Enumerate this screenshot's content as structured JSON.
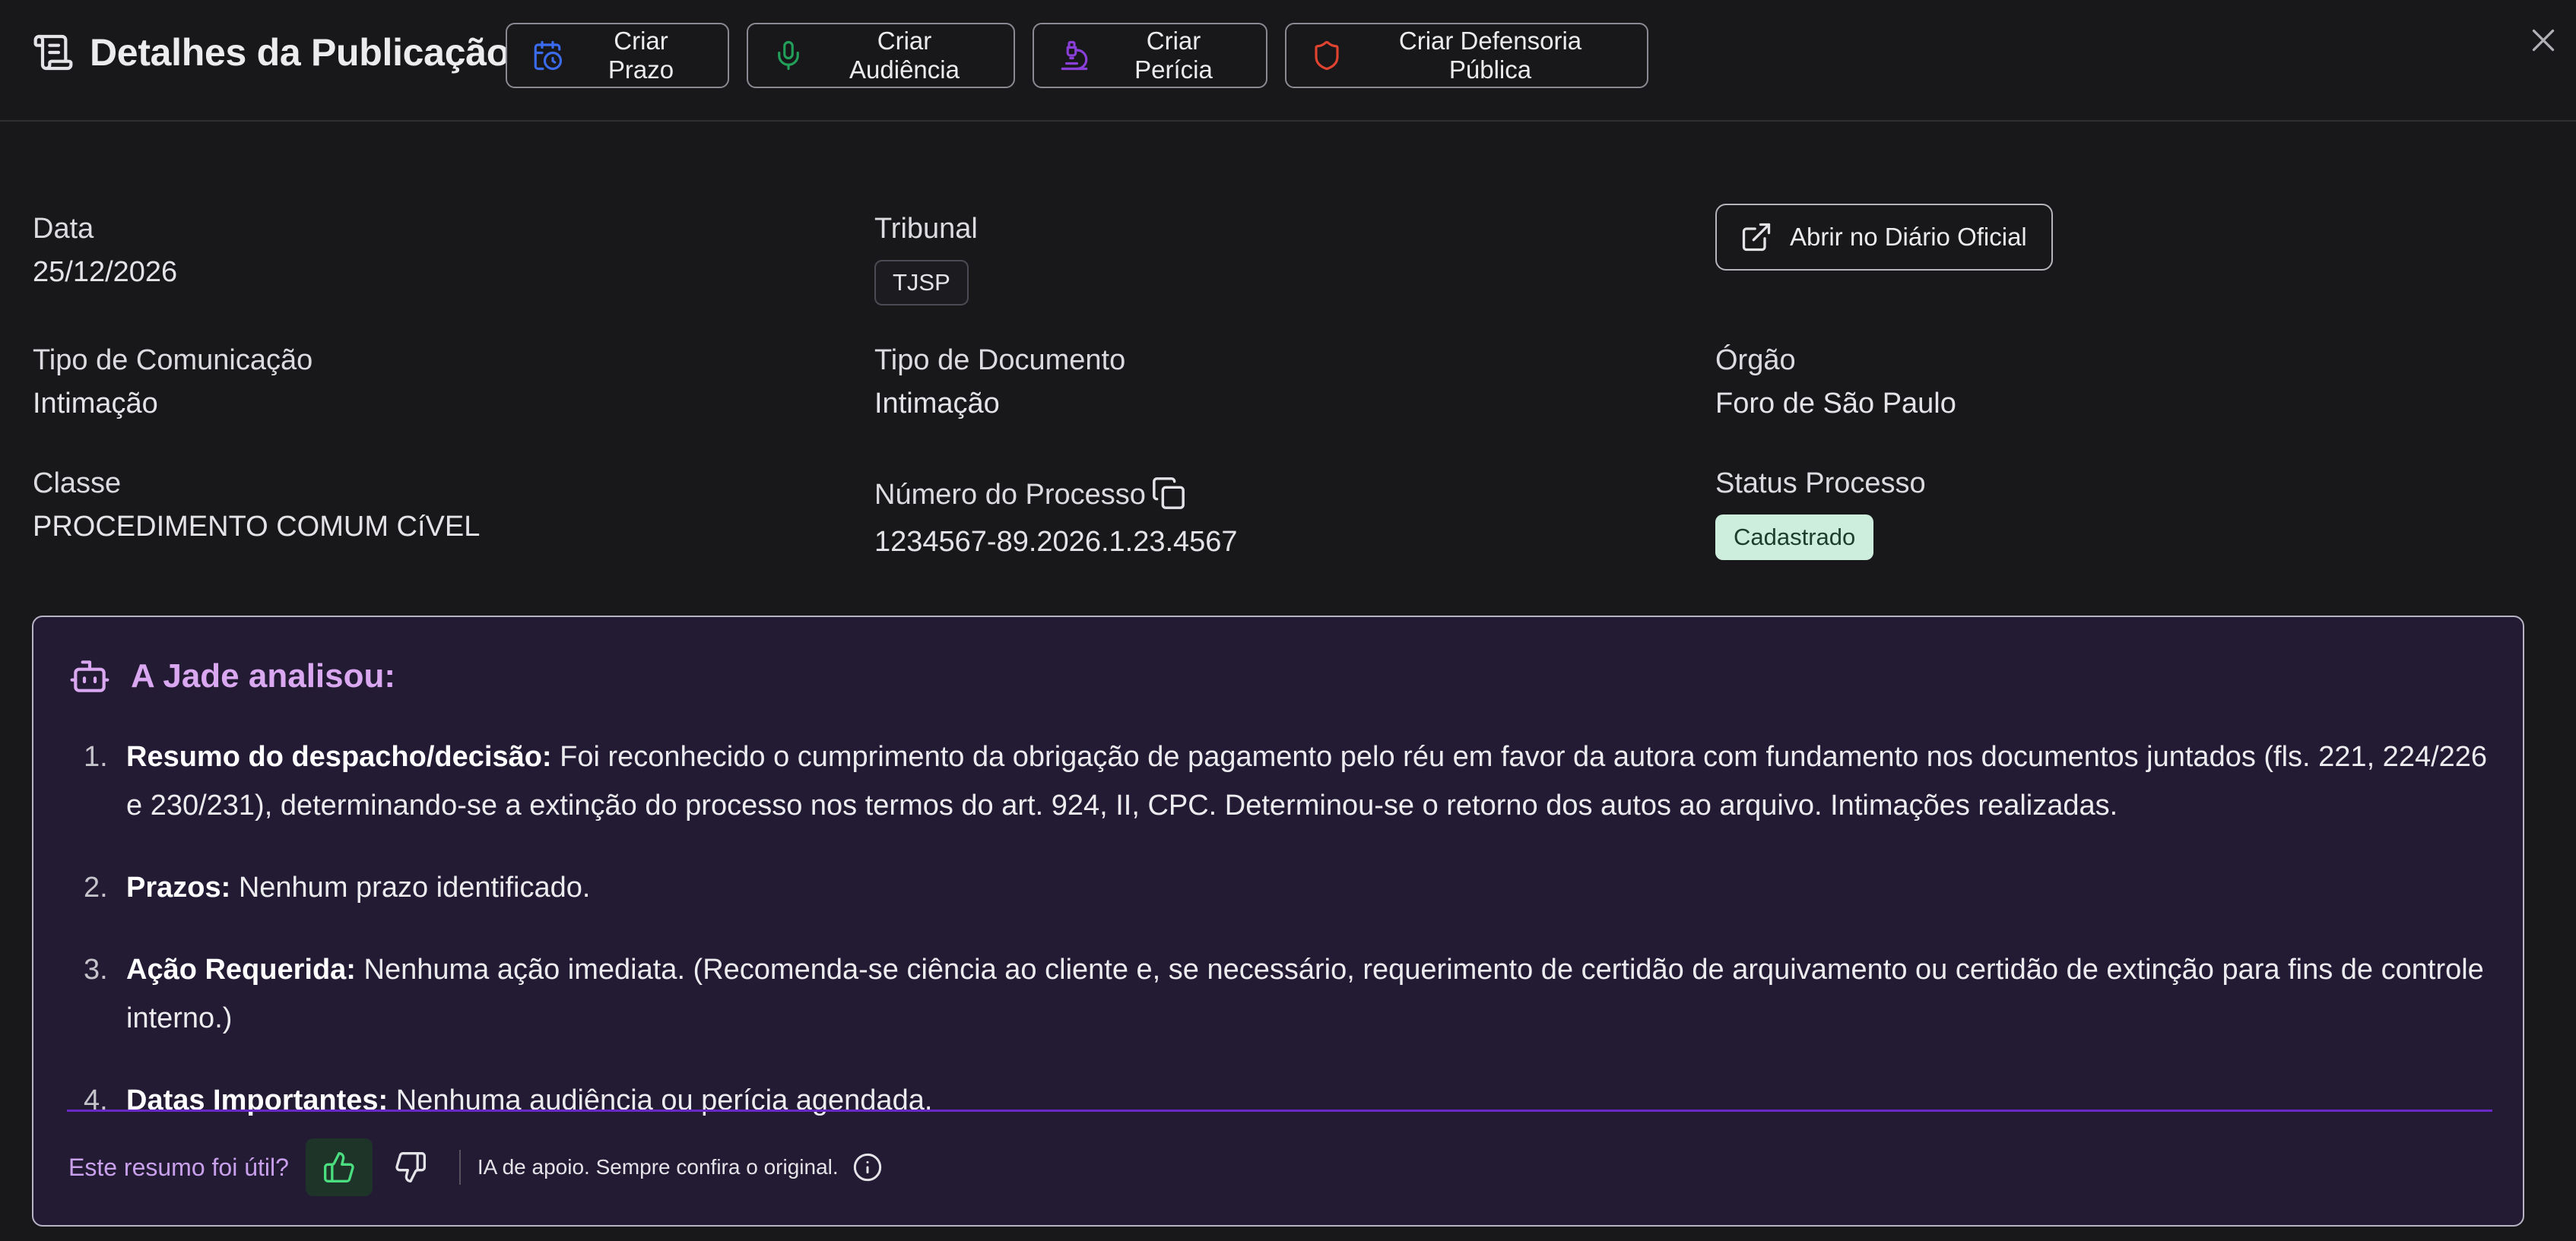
{
  "header": {
    "title": "Detalhes da Publicação",
    "buttons": [
      {
        "label": "Criar Prazo",
        "icon": "calendar-clock-icon",
        "color": "#3b6cf0"
      },
      {
        "label": "Criar Audiência",
        "icon": "microphone-icon",
        "color": "#22a05a"
      },
      {
        "label": "Criar Perícia",
        "icon": "microscope-icon",
        "color": "#8b3fd9"
      },
      {
        "label": "Criar Defensoria Pública",
        "icon": "shield-icon",
        "color": "#e0432f"
      }
    ],
    "close_icon": "close-icon"
  },
  "fields": {
    "data": {
      "label": "Data",
      "value": "25/12/2026"
    },
    "tribunal": {
      "label": "Tribunal",
      "value": "TJSP"
    },
    "open_button": {
      "label": "Abrir no Diário Oficial",
      "icon": "external-link-icon"
    },
    "tipo_comunicacao": {
      "label": "Tipo de Comunicação",
      "value": "Intimação"
    },
    "tipo_documento": {
      "label": "Tipo de Documento",
      "value": "Intimação"
    },
    "orgao": {
      "label": "Órgão",
      "value": "Foro de São Paulo"
    },
    "classe": {
      "label": "Classe",
      "value": "PROCEDIMENTO COMUM CíVEL"
    },
    "numero_processo": {
      "label": "Número do Processo",
      "value": "1234567-89.2026.1.23.4567",
      "icon": "copy-icon"
    },
    "status_processo": {
      "label": "Status Processo",
      "value": "Cadastrado",
      "color": "#cdeedd"
    }
  },
  "ai": {
    "title": "A Jade analisou:",
    "icon": "robot-icon",
    "items": [
      {
        "num": "1.",
        "label": "Resumo do despacho/decisão:",
        "text": " Foi reconhecido o cumprimento da obrigação de pagamento pelo réu em favor da autora com fundamento nos documentos juntados (fls. 221, 224/226 e 230/231), determinando-se a extinção do processo nos termos do art. 924, II, CPC. Determinou-se o retorno dos autos ao arquivo. Intimações realizadas."
      },
      {
        "num": "2.",
        "label": "Prazos:",
        "text": " Nenhum prazo identificado."
      },
      {
        "num": "3.",
        "label": "Ação Requerida:",
        "text": " Nenhuma ação imediata. (Recomenda-se ciência ao cliente e, se necessário, requerimento de certidão de arquivamento ou certidão de extinção para fins de controle interno.)"
      },
      {
        "num": "4.",
        "label": "Datas Importantes:",
        "text": " Nenhuma audiência ou perícia agendada."
      }
    ],
    "feedback_question": "Este resumo foi útil?",
    "disclaimer": "IA de apoio. Sempre confira o original.",
    "accent": "#6a28c8"
  }
}
